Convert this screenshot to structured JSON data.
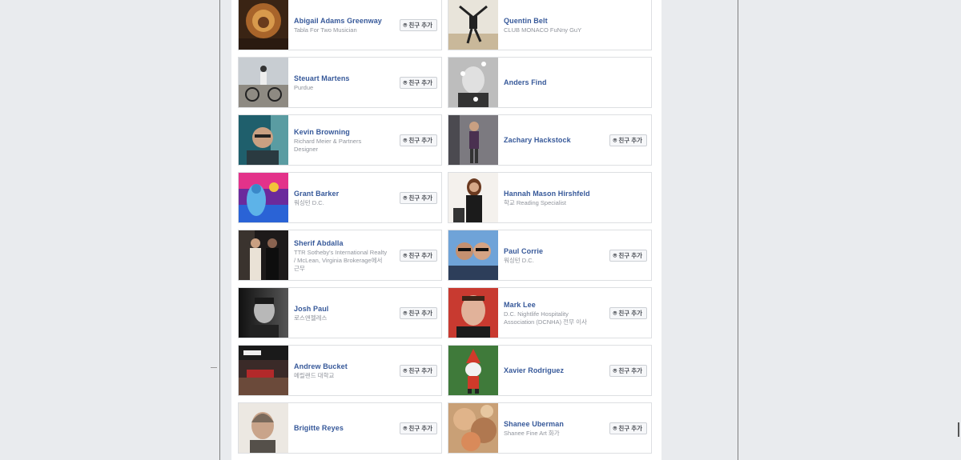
{
  "add_friend_label": "친구 추가",
  "cards": [
    {
      "name": "Abigail Adams Greenway",
      "sub": [
        "Tabla For Two Musician"
      ],
      "button": true
    },
    {
      "name": "Quentin Belt",
      "sub": [
        "CLUB MONACO FuNny GuY"
      ],
      "button": false
    },
    {
      "name": "Steuart Martens",
      "sub": [
        "Purdue"
      ],
      "button": true
    },
    {
      "name": "Anders Find",
      "sub": [],
      "button": false
    },
    {
      "name": "Kevin Browning",
      "sub": [
        "Richard Meier & Partners",
        "Designer"
      ],
      "button": true
    },
    {
      "name": "Zachary Hackstock",
      "sub": [],
      "button": true
    },
    {
      "name": "Grant Barker",
      "sub": [
        "워싱턴 D.C."
      ],
      "button": true
    },
    {
      "name": "Hannah Mason Hirshfeld",
      "sub": [
        "학교 Reading Specialist"
      ],
      "button": false
    },
    {
      "name": "Sherif Abdalla",
      "sub": [
        "TTR Sotheby's International Realty",
        "/ McLean, Virginia Brokerage에서",
        "근무"
      ],
      "button": true
    },
    {
      "name": "Paul Corrie",
      "sub": [
        "워싱턴 D.C."
      ],
      "button": true
    },
    {
      "name": "Josh Paul",
      "sub": [
        "로스앤젤레스"
      ],
      "button": true
    },
    {
      "name": "Mark Lee",
      "sub": [
        "D.C. Nightlife Hospitality",
        "Association (DCNHA) 전무 이사"
      ],
      "button": true
    },
    {
      "name": "Andrew Bucket",
      "sub": [
        "메릴랜드 대학교"
      ],
      "button": true
    },
    {
      "name": "Xavier Rodriguez",
      "sub": [],
      "button": true
    },
    {
      "name": "Brigitte Reyes",
      "sub": [],
      "button": true
    },
    {
      "name": "Shanee Uberman",
      "sub": [
        "Shanee Fine Art 화가"
      ],
      "button": true
    }
  ]
}
